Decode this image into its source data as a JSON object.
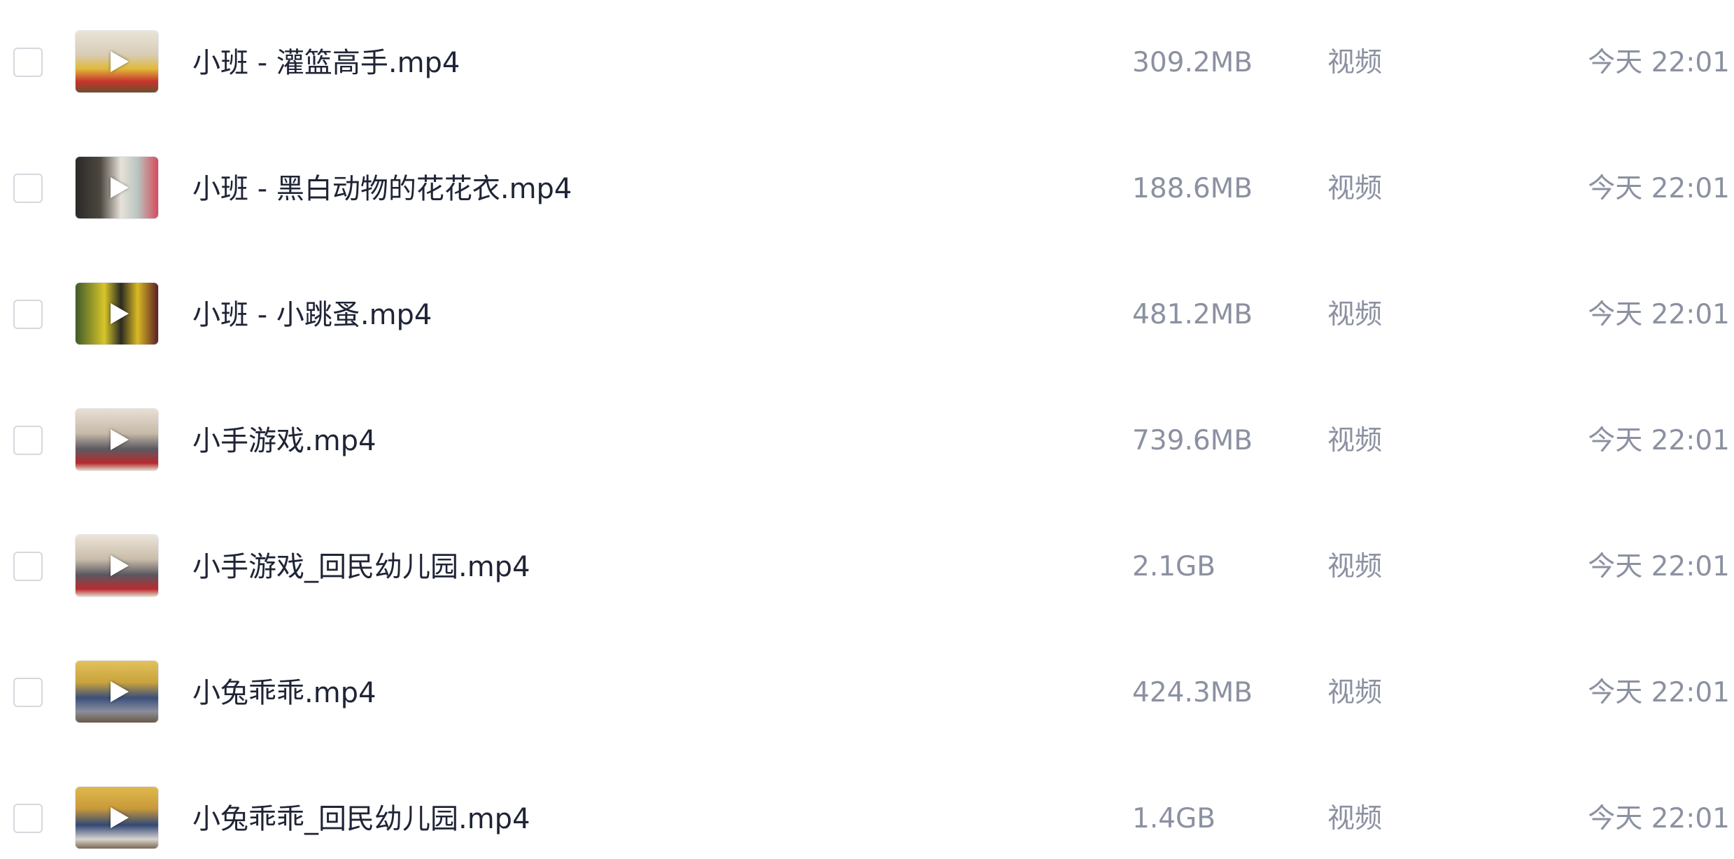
{
  "files": [
    {
      "name": "小班 - 灌篮高手.mp4",
      "size": "309.2MB",
      "type": "视频",
      "time": "今天 22:01",
      "thumb_icon": "video-thumbnail-icon"
    },
    {
      "name": "小班 - 黑白动物的花花衣.mp4",
      "size": "188.6MB",
      "type": "视频",
      "time": "今天 22:01",
      "thumb_icon": "video-thumbnail-icon"
    },
    {
      "name": "小班 - 小跳蚤.mp4",
      "size": "481.2MB",
      "type": "视频",
      "time": "今天 22:01",
      "thumb_icon": "video-thumbnail-icon"
    },
    {
      "name": "小手游戏.mp4",
      "size": "739.6MB",
      "type": "视频",
      "time": "今天 22:01",
      "thumb_icon": "video-thumbnail-icon"
    },
    {
      "name": "小手游戏_回民幼儿园.mp4",
      "size": "2.1GB",
      "type": "视频",
      "time": "今天 22:01",
      "thumb_icon": "video-thumbnail-icon"
    },
    {
      "name": "小兔乖乖.mp4",
      "size": "424.3MB",
      "type": "视频",
      "time": "今天 22:01",
      "thumb_icon": "video-thumbnail-icon"
    },
    {
      "name": "小兔乖乖_回民幼儿园.mp4",
      "size": "1.4GB",
      "type": "视频",
      "time": "今天 22:01",
      "thumb_icon": "video-thumbnail-icon"
    }
  ],
  "colors": {
    "name_text": "#1f2436",
    "meta_text": "#8b91a1",
    "checkbox_border": "#d6d8de",
    "background": "#ffffff"
  }
}
